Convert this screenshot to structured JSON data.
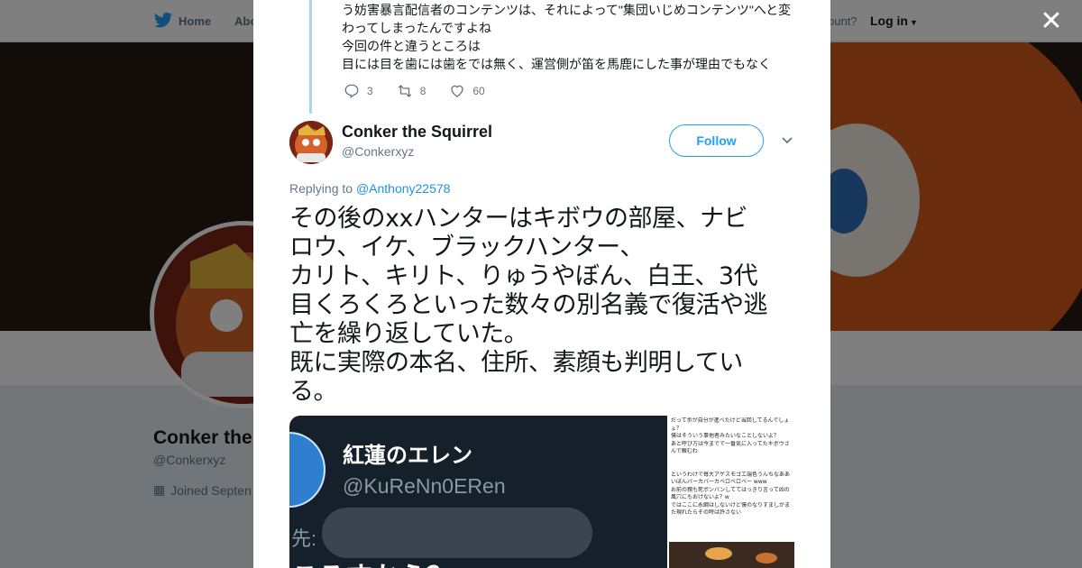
{
  "colors": {
    "brand_blue": "#1da1f2",
    "link_blue": "#1b95e0",
    "text": "#14171a",
    "muted": "#657786"
  },
  "background_page": {
    "nav": {
      "home_label": "Home",
      "about_label": "Abo",
      "account_prompt": "ccount?",
      "login_label": "Log in"
    },
    "profile": {
      "name": "Conker the",
      "handle": "@Conkerxyz",
      "joined": "Joined Septen"
    }
  },
  "modal": {
    "close_icon": "close-icon",
    "previous_tweet": {
      "lines": [
        "う妨害暴言配信者のコンテンツは、それによって\"集団いじめコンテンツ\"へと変",
        "わってしまったんですよね",
        "今回の件と違うところは",
        "目には目を歯には歯をでは無く、運営側が笛を馬鹿にした事が理由でもなく"
      ],
      "replies": "3",
      "retweets": "8",
      "likes": "60"
    },
    "tweet": {
      "author_name": "Conker the Squirrel",
      "author_handle": "@Conkerxyz",
      "follow_label": "Follow",
      "replying_prefix": "Replying to",
      "replying_to": "@Anthony22578",
      "text_lines": [
        "その後のxxハンターはキボウの部屋、ナビ",
        "ロウ、イケ、ブラックハンター、",
        "カリト、キリト、りゅうやぼん、白王、3代",
        "目くろくろといった数々の別名義で復活や逃",
        "亡を繰り返していた。",
        "既に実際の本名、住所、素顔も判明してい",
        "る。"
      ],
      "media": {
        "embedded_name": "紅蓮のエレン",
        "embedded_handle": "@KuReNn0ERen",
        "embedded_to": "先:",
        "embedded_tail": "ころすから？",
        "right_lines": [
          "だって歩が自分が進べたけど当回してるんでしょ",
          "ょ？",
          "僕はそういう事他者みたいなことしないよ？",
          "あと呼び方は今までで一番気に入ってたキボウさ",
          "んで頼むわ",
          "",
          "",
          "というわけで毎大アゲスモゴエ端色うんちなああ",
          "いぼんバーカバーカベロベロベー www",
          "お前の親も死ポンバンしててはっきり言って凶の",
          "風穴にもおけないよ？w",
          "ではここに永綱はしないけど僕のなりすましがま",
          "た現れたらその時は許さない"
        ]
      }
    }
  }
}
